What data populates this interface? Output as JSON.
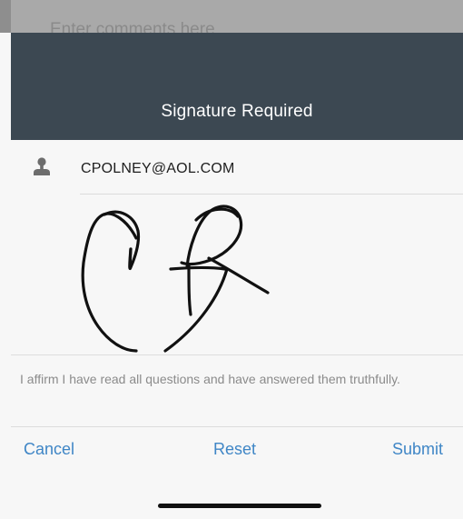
{
  "background": {
    "comments_placeholder": "Enter comments here"
  },
  "modal": {
    "title": "Signature Required",
    "email": "CPOLNEY@AOL.COM",
    "user_icon": "user-icon",
    "affirmation": "I affirm I have read all questions and have answered them truthfully.",
    "actions": {
      "cancel_label": "Cancel",
      "reset_label": "Reset",
      "submit_label": "Submit"
    }
  },
  "colors": {
    "header_bg": "#3c4852",
    "action_blue": "#3f86c6",
    "body_bg": "#f7f7f7"
  }
}
